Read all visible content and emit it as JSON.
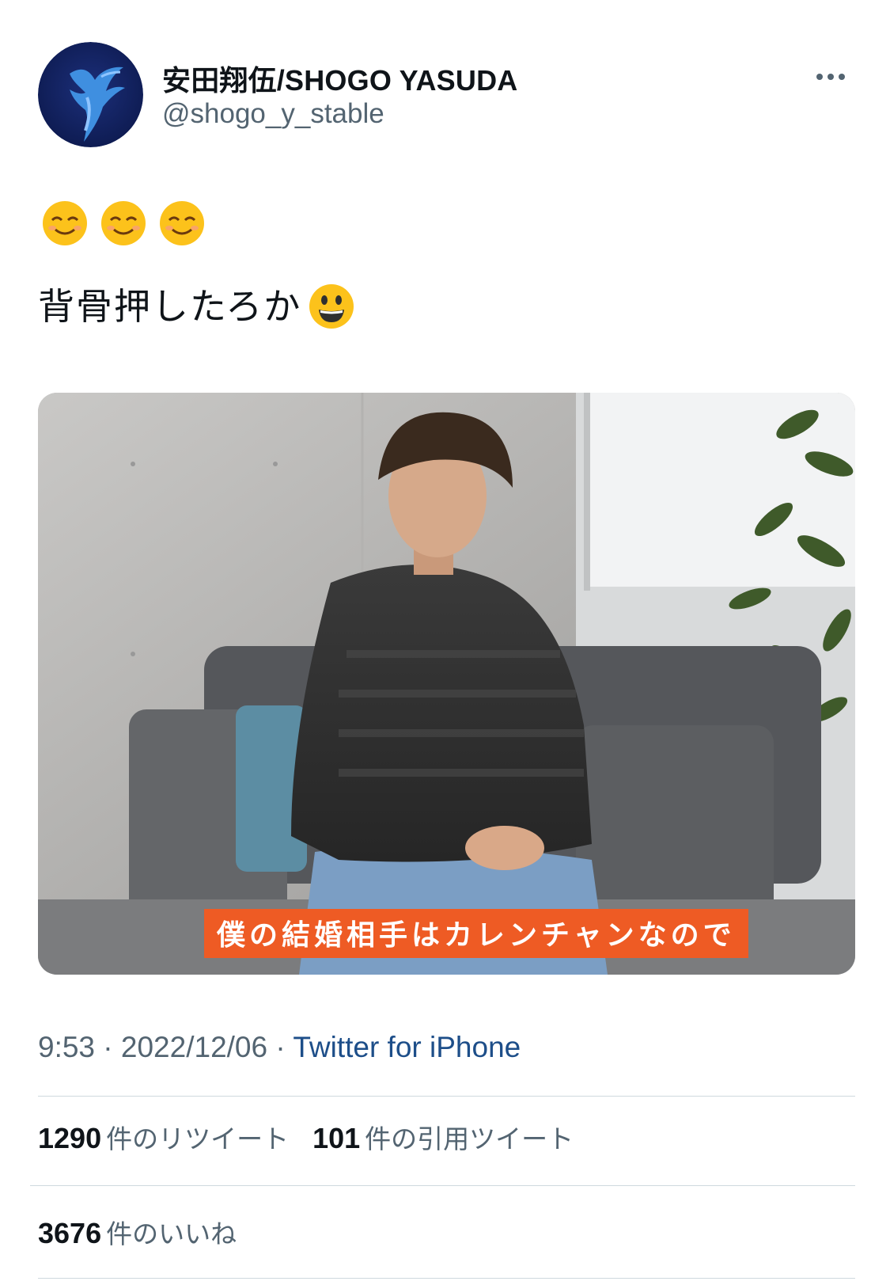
{
  "author": {
    "display_name": "安田翔伍/SHOGO YASUDA",
    "handle": "@shogo_y_stable",
    "avatar_icon": "pegasus-logo-icon"
  },
  "tweet": {
    "emoji_line": [
      "☺️",
      "☺️",
      "☺️"
    ],
    "text": "背骨押したろか",
    "text_emoji": "😃"
  },
  "media": {
    "caption": "僕の結婚相手はカレンチャンなので"
  },
  "meta": {
    "time": "9:53",
    "date": "2022/12/06",
    "separator": " · ",
    "source": "Twitter for iPhone"
  },
  "stats": {
    "retweets_count": "1290",
    "retweets_label": "件のリツイート",
    "quotes_count": "101",
    "quotes_label": "件の引用ツイート",
    "likes_count": "3676",
    "likes_label": "件のいいね"
  },
  "colors": {
    "secondary_text": "#536471",
    "link": "#1d4e89",
    "caption_bg": "#ee5b24",
    "divider": "#cfd9de"
  }
}
